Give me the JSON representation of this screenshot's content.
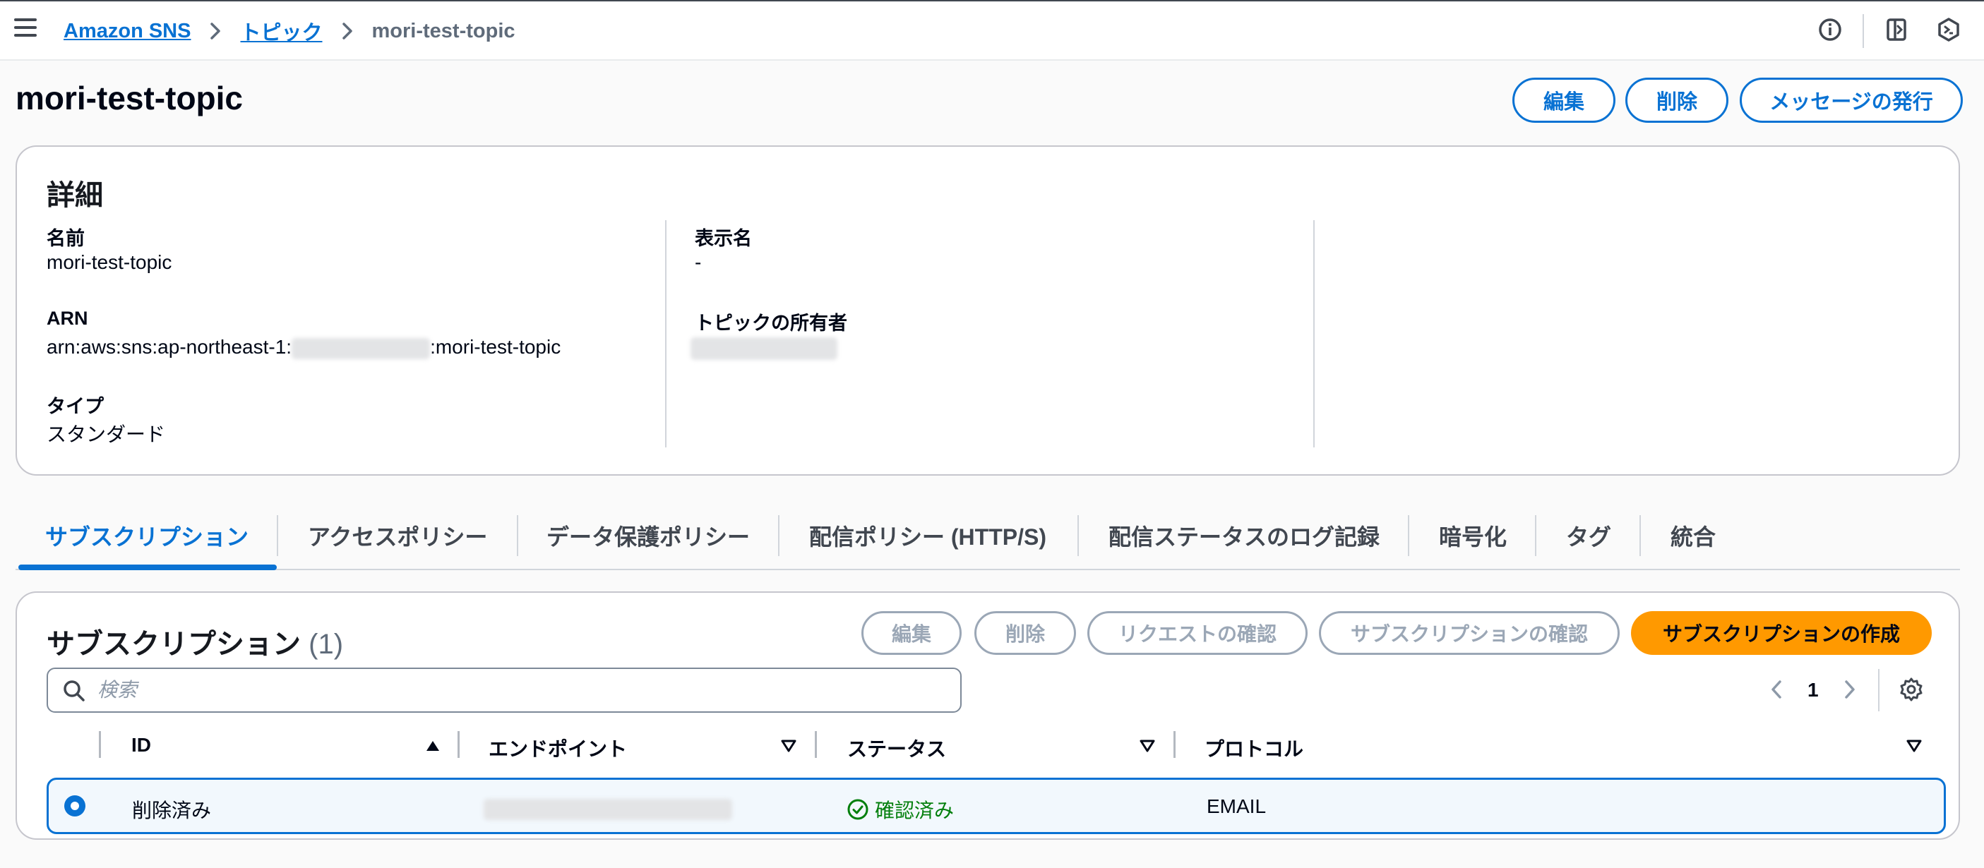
{
  "breadcrumb": {
    "items": [
      "Amazon SNS",
      "トピック"
    ],
    "current": "mori-test-topic"
  },
  "header": {
    "title": "mori-test-topic",
    "buttons": {
      "edit": "編集",
      "delete": "削除",
      "publish": "メッセージの発行"
    }
  },
  "details": {
    "title": "詳細",
    "name_label": "名前",
    "name_value": "mori-test-topic",
    "arn_label": "ARN",
    "arn_prefix": "arn:aws:sns:ap-northeast-1:",
    "arn_suffix": ":mori-test-topic",
    "type_label": "タイプ",
    "type_value": "スタンダード",
    "display_name_label": "表示名",
    "display_name_value": "-",
    "owner_label": "トピックの所有者"
  },
  "tabs": [
    "サブスクリプション",
    "アクセスポリシー",
    "データ保護ポリシー",
    "配信ポリシー (HTTP/S)",
    "配信ステータスのログ記録",
    "暗号化",
    "タグ",
    "統合"
  ],
  "subscriptions": {
    "title": "サブスクリプション",
    "count": "(1)",
    "buttons": {
      "edit": "編集",
      "delete": "削除",
      "confirm_request": "リクエストの確認",
      "confirm_subscription": "サブスクリプションの確認",
      "create": "サブスクリプションの作成"
    },
    "search_placeholder": "検索",
    "page": "1",
    "columns": [
      "ID",
      "エンドポイント",
      "ステータス",
      "プロトコル"
    ],
    "rows": [
      {
        "id": "削除済み",
        "status": "確認済み",
        "protocol": "EMAIL"
      }
    ]
  },
  "colors": {
    "link": "#0972d3",
    "primary_button": "#ff9900",
    "status_success": "#037f0c",
    "disabled": "#9ba7b6"
  },
  "icons": [
    "menu-icon",
    "chevron-right-icon",
    "info-icon",
    "panel-icon",
    "cloudshell-icon",
    "search-icon",
    "chevron-left-icon",
    "settings-icon",
    "caret-up-icon",
    "caret-down-icon",
    "check-circle-icon"
  ]
}
